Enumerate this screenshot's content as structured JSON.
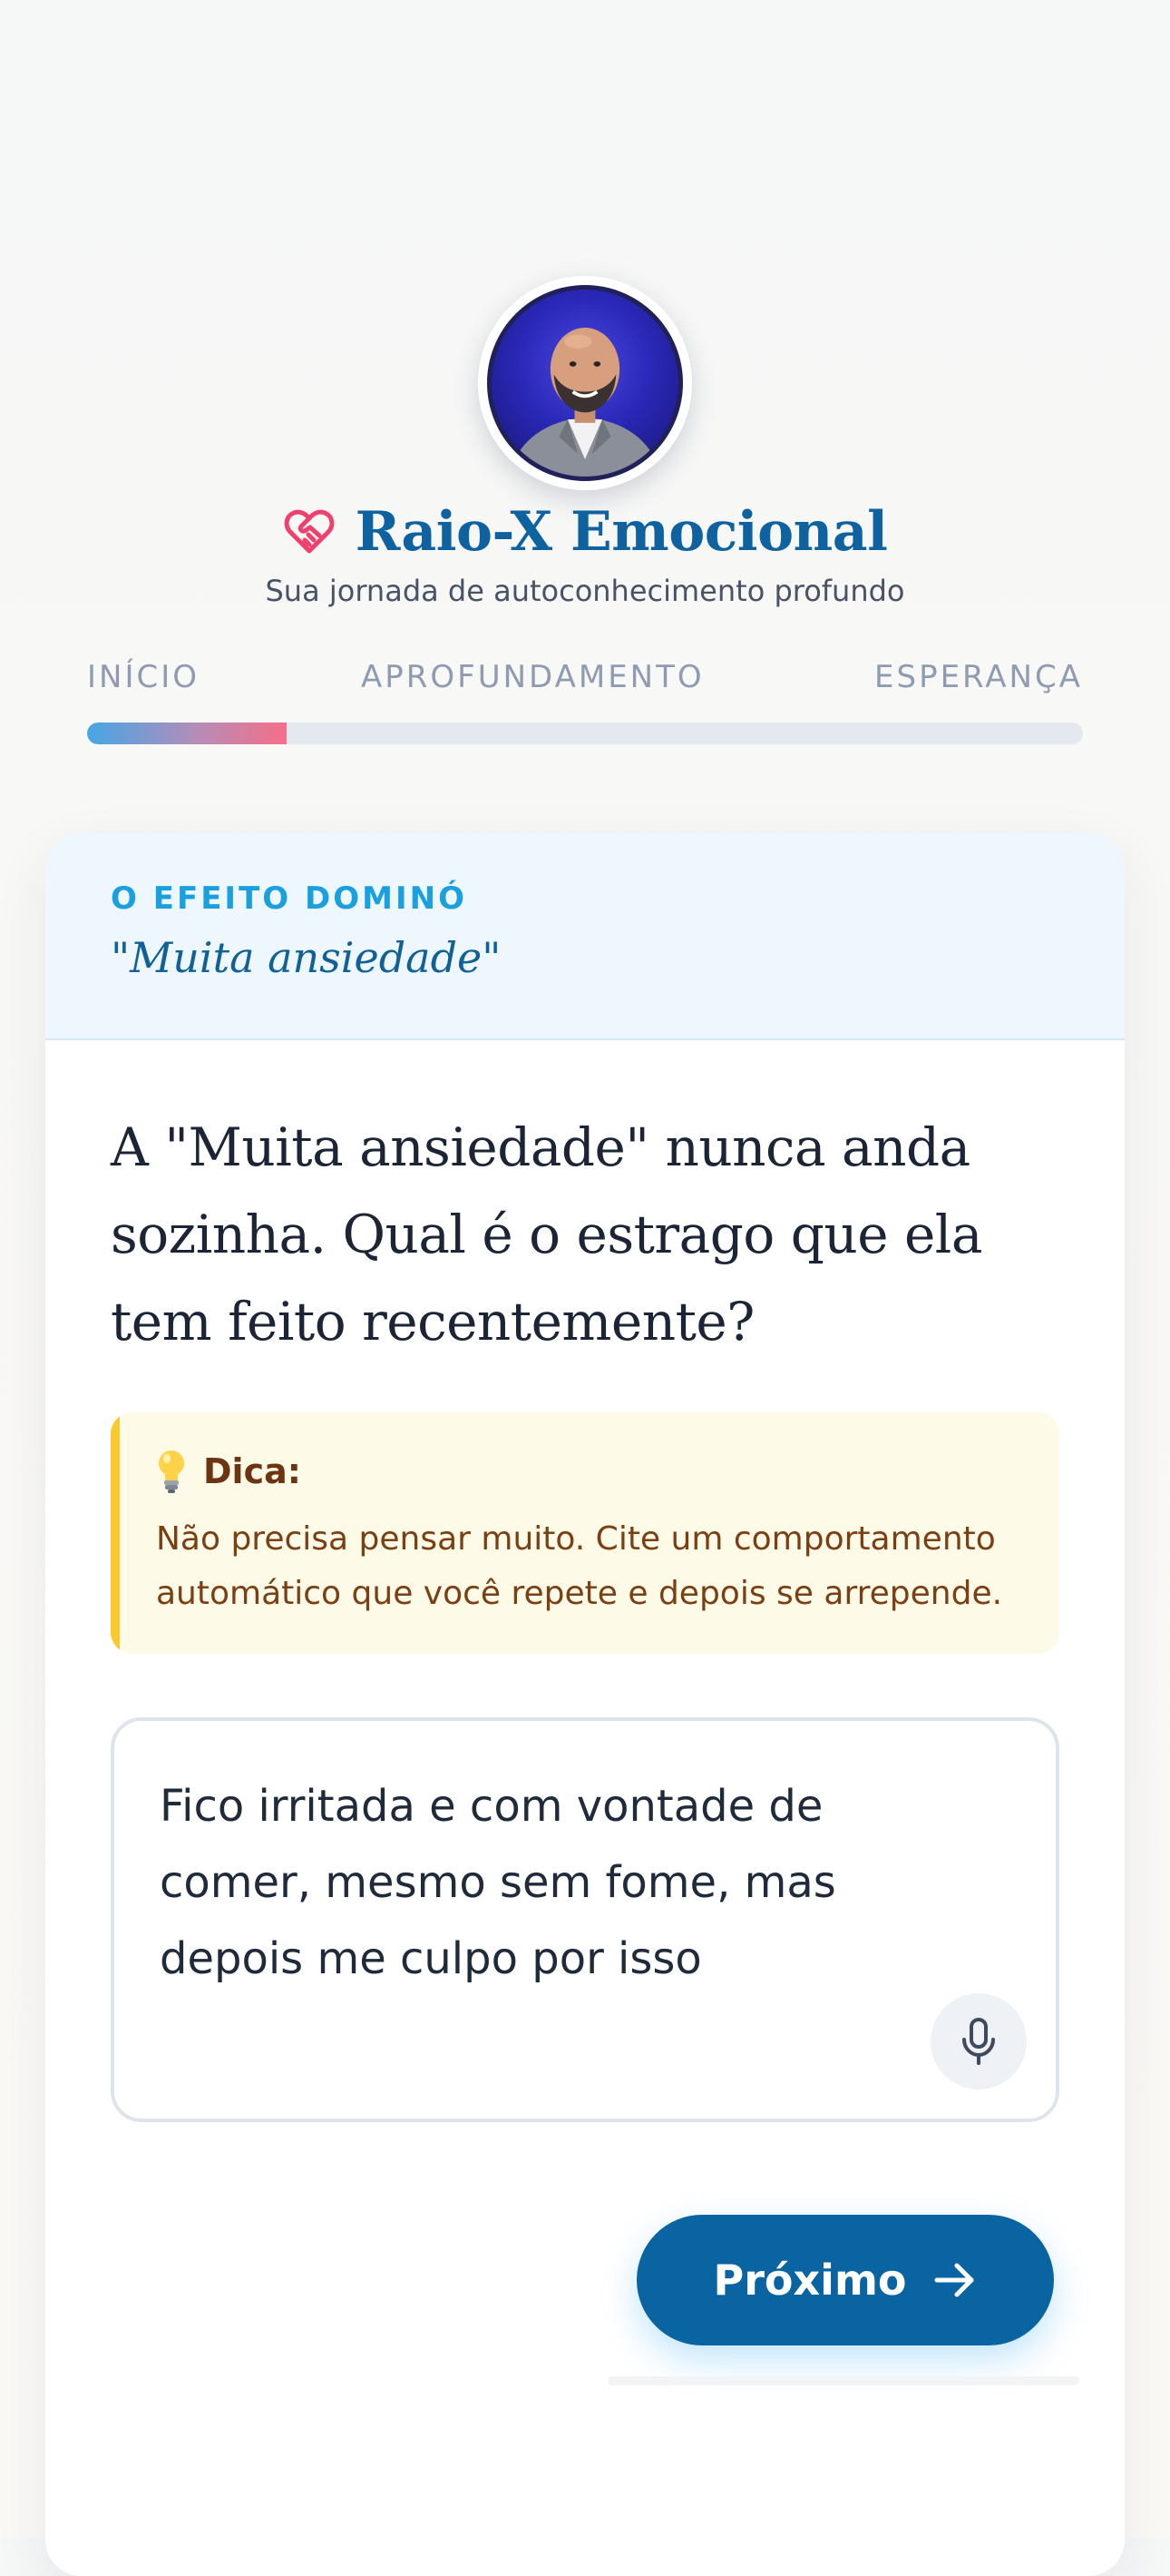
{
  "header": {
    "avatar_alt": "Foto do especialista",
    "title": "Raio-X Emocional",
    "subtitle": "Sua jornada de autoconhecimento profundo",
    "brand_icon": "heart-handshake-icon"
  },
  "steps": {
    "items": [
      "INÍCIO",
      "APROFUNDAMENTO",
      "ESPERANÇA"
    ],
    "progress_fraction": 0.2
  },
  "card": {
    "section_label": "O EFEITO DOMINÓ",
    "section_quote": "\"Muita ansiedade\"",
    "question": "A \"Muita ansiedade\" nunca anda sozinha. Qual é o estrago que ela tem feito recentemente?",
    "tip": {
      "icon": "lightbulb-icon",
      "title": "Dica:",
      "body": "Não precisa pensar muito. Cite um comportamento automático que você repete e depois se arrepende."
    },
    "answer": {
      "value": "Fico irritada e com vontade de comer, mesmo sem fome, mas depois me culpo por isso",
      "mic_icon": "microphone-icon"
    },
    "next_button": {
      "label": "Próximo",
      "icon": "arrow-right-icon"
    }
  },
  "colors": {
    "brand": "#0e62a0",
    "accent_pink": "#f0406e",
    "section_label": "#1ba0df",
    "button": "#0a64a2",
    "tip_border": "#f9c92e"
  }
}
